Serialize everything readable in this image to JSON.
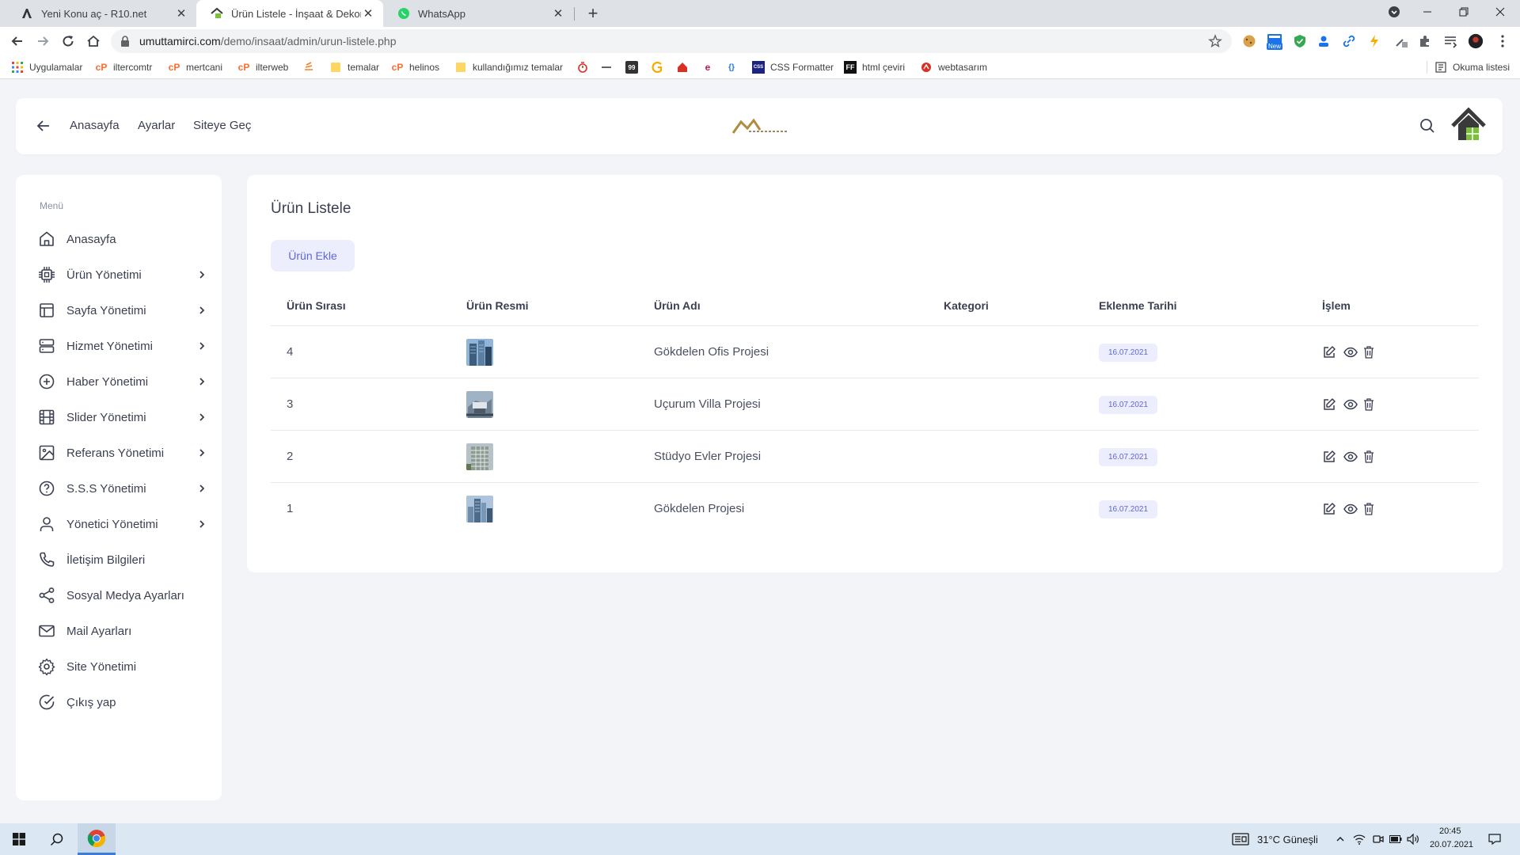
{
  "browser": {
    "tabs": [
      {
        "title": "Yeni Konu aç - R10.net",
        "active": false
      },
      {
        "title": "Ürün Listele - İnşaat & Dekorasyon",
        "active": true
      },
      {
        "title": "WhatsApp",
        "active": false
      }
    ],
    "address": {
      "host": "umuttamirci.com",
      "path": "/demo/insaat/admin/urun-listele.php"
    },
    "bookmarks": [
      {
        "label": "Uygulamalar",
        "icon": "apps-grid-icon"
      },
      {
        "label": "iltercomtr",
        "icon": "cpanel-icon"
      },
      {
        "label": "mertcani",
        "icon": "cpanel-icon"
      },
      {
        "label": "ilterweb",
        "icon": "cpanel-icon"
      },
      {
        "label": "",
        "icon": "stack-icon"
      },
      {
        "label": "temalar",
        "icon": "folder-icon"
      },
      {
        "label": "helinos",
        "icon": "cpanel-icon"
      },
      {
        "label": "kullandığımız temalar",
        "icon": "folder-icon"
      },
      {
        "label": "CSS Formatter",
        "icon": "css-icon"
      },
      {
        "label": "html çeviri",
        "icon": "ff-icon"
      },
      {
        "label": "webtasarım",
        "icon": "webtasarim-icon"
      }
    ],
    "reading_list": "Okuma listesi",
    "ext_badge": "New"
  },
  "header": {
    "nav": [
      "Anasayfa",
      "Ayarlar",
      "Siteye Geç"
    ]
  },
  "sidebar": {
    "title": "Menü",
    "items": [
      {
        "label": "Anasayfa",
        "icon": "home-icon",
        "submenu": false
      },
      {
        "label": "Ürün Yönetimi",
        "icon": "chip-icon",
        "submenu": true
      },
      {
        "label": "Sayfa Yönetimi",
        "icon": "layout-icon",
        "submenu": true
      },
      {
        "label": "Hizmet Yönetimi",
        "icon": "server-icon",
        "submenu": true
      },
      {
        "label": "Haber Yönetimi",
        "icon": "plus-circle-icon",
        "submenu": true
      },
      {
        "label": "Slider Yönetimi",
        "icon": "film-icon",
        "submenu": true
      },
      {
        "label": "Referans Yönetimi",
        "icon": "image-icon",
        "submenu": true
      },
      {
        "label": "S.S.S Yönetimi",
        "icon": "help-circle-icon",
        "submenu": true
      },
      {
        "label": "Yönetici Yönetimi",
        "icon": "user-icon",
        "submenu": true
      },
      {
        "label": "İletişim Bilgileri",
        "icon": "phone-icon",
        "submenu": false
      },
      {
        "label": "Sosyal Medya Ayarları",
        "icon": "share-icon",
        "submenu": false
      },
      {
        "label": "Mail Ayarları",
        "icon": "mail-icon",
        "submenu": false
      },
      {
        "label": "Site Yönetimi",
        "icon": "settings-icon",
        "submenu": false
      },
      {
        "label": "Çıkış yap",
        "icon": "check-circle-icon",
        "submenu": false
      }
    ]
  },
  "content": {
    "title": "Ürün Listele",
    "add_button": "Ürün Ekle",
    "columns": [
      "Ürün Sırası",
      "Ürün Resmi",
      "Ürün Adı",
      "Kategori",
      "Eklenme Tarihi",
      "İşlem"
    ],
    "rows": [
      {
        "order": "4",
        "name": "Gökdelen Ofis Projesi",
        "category": "",
        "date": "16.07.2021"
      },
      {
        "order": "3",
        "name": "Uçurum Villa Projesi",
        "category": "",
        "date": "16.07.2021"
      },
      {
        "order": "2",
        "name": "Stüdyo Evler Projesi",
        "category": "",
        "date": "16.07.2021"
      },
      {
        "order": "1",
        "name": "Gökdelen Projesi",
        "category": "",
        "date": "16.07.2021"
      }
    ]
  },
  "taskbar": {
    "weather": "31°C  Güneşli",
    "time": "20:45",
    "date": "20.07.2021"
  },
  "colors": {
    "accent": "#5e66d8",
    "accent_bg": "#eceefd",
    "page_bg": "#f3f4f8",
    "text": "#3a3f51"
  }
}
